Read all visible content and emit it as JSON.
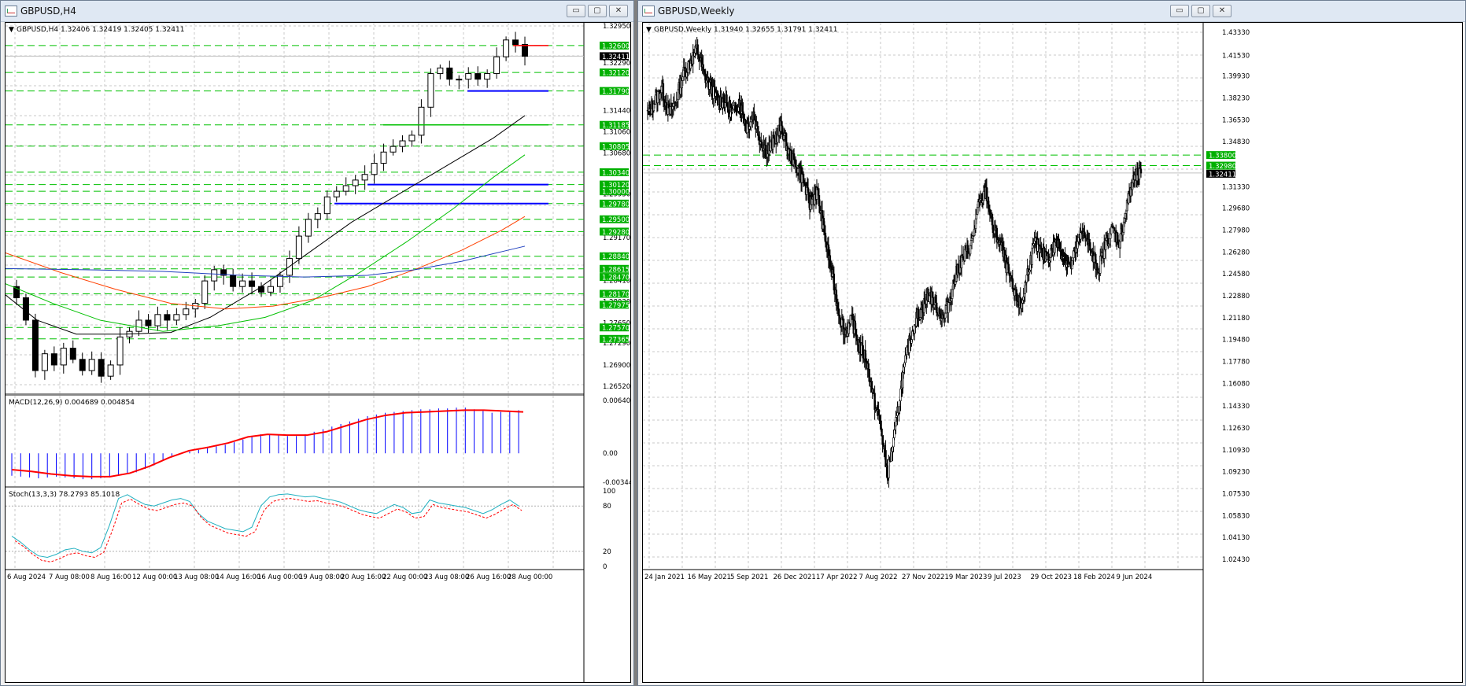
{
  "left": {
    "window_title": "GBPUSD,H4",
    "header": "GBPUSD,H4  1.32406 1.32419 1.32405 1.32411",
    "macd_label": "MACD(12,26,9) 0.004689 0.004854",
    "stoch_label": "Stoch(13,3,3) 78.2793 85.1018",
    "price_axis": [
      "1.32950",
      "1.32290",
      "1.31440",
      "1.31060",
      "1.30680",
      "1.29950",
      "1.29170",
      "1.28410",
      "1.28030",
      "1.27650",
      "1.27290",
      "1.26900",
      "1.26520"
    ],
    "badges": [
      {
        "text": "1.32600",
        "color": "#00b000"
      },
      {
        "text": "1.32411",
        "color": "#000000"
      },
      {
        "text": "1.32120",
        "color": "#00b000"
      },
      {
        "text": "1.31790",
        "color": "#00b000"
      },
      {
        "text": "1.31185",
        "color": "#00b000"
      },
      {
        "text": "1.30805",
        "color": "#00b000"
      },
      {
        "text": "1.30340",
        "color": "#00b000"
      },
      {
        "text": "1.30120",
        "color": "#00b000"
      },
      {
        "text": "1.30000",
        "color": "#00b000"
      },
      {
        "text": "1.29780",
        "color": "#00b000"
      },
      {
        "text": "1.29500",
        "color": "#00b000"
      },
      {
        "text": "1.29280",
        "color": "#00b000"
      },
      {
        "text": "1.28840",
        "color": "#00b000"
      },
      {
        "text": "1.28615",
        "color": "#00b000"
      },
      {
        "text": "1.28470",
        "color": "#00b000"
      },
      {
        "text": "1.28170",
        "color": "#00b000"
      },
      {
        "text": "1.27975",
        "color": "#00b000"
      },
      {
        "text": "1.27570",
        "color": "#00b000"
      },
      {
        "text": "1.27365",
        "color": "#00b000"
      }
    ],
    "macd_axis": [
      "0.006402",
      "0.00",
      "-0.003445"
    ],
    "stoch_axis": [
      "100",
      "80",
      "20",
      "0"
    ],
    "time_axis": [
      "6 Aug 2024",
      "7 Aug 08:00",
      "8 Aug 16:00",
      "12 Aug 00:00",
      "13 Aug 08:00",
      "14 Aug 16:00",
      "16 Aug 00:00",
      "19 Aug 08:00",
      "20 Aug 16:00",
      "22 Aug 00:00",
      "23 Aug 08:00",
      "26 Aug 16:00",
      "28 Aug 00:00"
    ]
  },
  "right": {
    "window_title": "GBPUSD,Weekly",
    "header": "GBPUSD,Weekly  1.31940 1.32655 1.31791 1.32411",
    "price_axis": [
      "1.43330",
      "1.41530",
      "1.39930",
      "1.38230",
      "1.36530",
      "1.34830",
      "1.31330",
      "1.29680",
      "1.27980",
      "1.26280",
      "1.24580",
      "1.22880",
      "1.21180",
      "1.19480",
      "1.17780",
      "1.16080",
      "1.14330",
      "1.12630",
      "1.10930",
      "1.09230",
      "1.07530",
      "1.05830",
      "1.04130",
      "1.02430"
    ],
    "badges": [
      {
        "text": "1.33800",
        "color": "#00b000"
      },
      {
        "text": "1.32980",
        "color": "#00b000"
      },
      {
        "text": "1.32411",
        "color": "#000000"
      }
    ],
    "time_axis": [
      "24 Jan 2021",
      "16 May 2021",
      "5 Sep 2021",
      "26 Dec 2021",
      "17 Apr 2022",
      "7 Aug 2022",
      "27 Nov 2022",
      "19 Mar 2023",
      "9 Jul 2023",
      "29 Oct 2023",
      "18 Feb 2024",
      "9 Jun 2024"
    ]
  },
  "window_buttons": {
    "minimize": "▭",
    "maximize": "▢",
    "close": "✕"
  },
  "colors": {
    "bull": "#ffffff",
    "bear": "#000000",
    "grid": "#c8c8c8",
    "support": "#00c000",
    "blue_level": "#0000ff",
    "red_level": "#ff0000",
    "ma_black": "#000000",
    "ma_green": "#00c000",
    "ma_red": "#ff4000",
    "ma_blue": "#1f3fbf",
    "macd_hist": "#0000ff",
    "macd_signal": "#ff0000",
    "stoch_main": "#20b0c0",
    "stoch_signal": "#ff0000"
  },
  "chart_data": [
    {
      "type": "candlestick",
      "symbol": "GBPUSD",
      "timeframe": "H4",
      "ylim": [
        1.2652,
        1.3295
      ],
      "last_price": 1.32411,
      "horizontal_levels": [
        1.326,
        1.3212,
        1.3179,
        1.31185,
        1.30805,
        1.3034,
        1.3012,
        1.3,
        1.2978,
        1.295,
        1.2928,
        1.2884,
        1.28615,
        1.2847,
        1.2817,
        1.27975,
        1.2757,
        1.27365
      ],
      "blue_levels": [
        1.3179,
        1.3012,
        1.2978
      ],
      "red_level": 1.326,
      "green_solid_level": 1.31185,
      "close_path": [
        1.281,
        1.277,
        1.268,
        1.271,
        1.269,
        1.272,
        1.27,
        1.268,
        1.27,
        1.267,
        1.269,
        1.274,
        1.275,
        1.277,
        1.276,
        1.278,
        1.277,
        1.278,
        1.279,
        1.28,
        1.284,
        1.286,
        1.285,
        1.283,
        1.284,
        1.283,
        1.282,
        1.283,
        1.285,
        1.288,
        1.292,
        1.295,
        1.296,
        1.299,
        1.3,
        1.301,
        1.302,
        1.303,
        1.305,
        1.307,
        1.308,
        1.309,
        1.31,
        1.315,
        1.321,
        1.322,
        1.32,
        1.32,
        1.321,
        1.32,
        1.321,
        1.324,
        1.327,
        1.3262,
        1.3241
      ],
      "moving_averages": [
        "black",
        "green",
        "red",
        "blue"
      ]
    },
    {
      "type": "macd",
      "params": "12,26,9",
      "main": 0.004689,
      "signal": 0.004854,
      "ylim": [
        -0.003445,
        0.006402
      ]
    },
    {
      "type": "stochastic",
      "params": "13,3,3",
      "main": 78.2793,
      "signal": 85.1018,
      "ylim": [
        0,
        100
      ],
      "levels": [
        20,
        80
      ]
    },
    {
      "type": "candlestick",
      "symbol": "GBPUSD",
      "timeframe": "Weekly",
      "ylim": [
        1.0243,
        1.4333
      ],
      "last_price": 1.32411,
      "horizontal_levels": [
        1.338,
        1.3298
      ],
      "close_path": [
        1.37,
        1.38,
        1.39,
        1.37,
        1.38,
        1.4,
        1.41,
        1.42,
        1.4,
        1.39,
        1.38,
        1.38,
        1.37,
        1.38,
        1.36,
        1.37,
        1.35,
        1.34,
        1.35,
        1.36,
        1.34,
        1.33,
        1.32,
        1.3,
        1.31,
        1.28,
        1.25,
        1.22,
        1.2,
        1.21,
        1.19,
        1.18,
        1.15,
        1.13,
        1.09,
        1.12,
        1.16,
        1.19,
        1.21,
        1.22,
        1.23,
        1.22,
        1.21,
        1.23,
        1.25,
        1.26,
        1.27,
        1.3,
        1.31,
        1.28,
        1.27,
        1.25,
        1.23,
        1.22,
        1.25,
        1.27,
        1.26,
        1.26,
        1.27,
        1.26,
        1.25,
        1.27,
        1.28,
        1.26,
        1.25,
        1.27,
        1.28,
        1.27,
        1.3,
        1.32,
        1.324
      ]
    }
  ]
}
